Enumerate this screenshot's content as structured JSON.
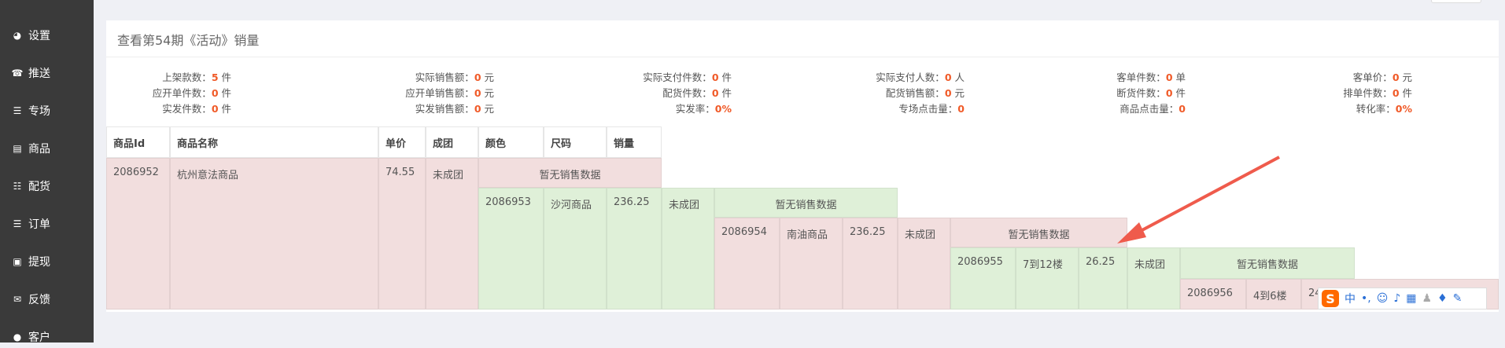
{
  "sidebar": {
    "items": [
      {
        "label": "设置",
        "icon": "dashboard-icon",
        "glyph": "◕"
      },
      {
        "label": "推送",
        "icon": "phone-icon",
        "glyph": "☎"
      },
      {
        "label": "专场",
        "icon": "list-icon",
        "glyph": "☰"
      },
      {
        "label": "商品",
        "icon": "card-icon",
        "glyph": "▤"
      },
      {
        "label": "配货",
        "icon": "list-ol-icon",
        "glyph": "☷"
      },
      {
        "label": "订单",
        "icon": "list-icon",
        "glyph": "☰"
      },
      {
        "label": "提现",
        "icon": "money-icon",
        "glyph": "▣"
      },
      {
        "label": "反馈",
        "icon": "comments-icon",
        "glyph": "✉"
      },
      {
        "label": "客户",
        "icon": "user-icon",
        "glyph": "●"
      }
    ]
  },
  "panel": {
    "title": "查看第54期《活动》销量"
  },
  "stats": [
    {
      "label": "上架款数：",
      "value": "5",
      "unit": " 件"
    },
    {
      "label": "应开单件数：",
      "value": "0",
      "unit": " 件"
    },
    {
      "label": "实发件数：",
      "value": "0",
      "unit": " 件"
    },
    {
      "label": "实际销售额：",
      "value": "0",
      "unit": " 元"
    },
    {
      "label": "应开单销售额：",
      "value": "0",
      "unit": " 元"
    },
    {
      "label": "实发销售额：",
      "value": "0",
      "unit": " 元"
    },
    {
      "label": "实际支付件数：",
      "value": "0",
      "unit": " 件"
    },
    {
      "label": "配货件数：",
      "value": "0",
      "unit": " 件"
    },
    {
      "label": "实发率：",
      "value": "0%",
      "unit": ""
    },
    {
      "label": "实际支付人数：",
      "value": "0",
      "unit": " 人"
    },
    {
      "label": "配货销售额：",
      "value": "0",
      "unit": " 元"
    },
    {
      "label": "专场点击量：",
      "value": "0",
      "unit": ""
    },
    {
      "label": "客单件数：",
      "value": "0",
      "unit": " 单"
    },
    {
      "label": "断货件数：",
      "value": "0",
      "unit": " 件"
    },
    {
      "label": "商品点击量：",
      "value": "0",
      "unit": ""
    },
    {
      "label": "客单价：",
      "value": "0",
      "unit": " 元"
    },
    {
      "label": "排单件数：",
      "value": "0",
      "unit": " 件"
    },
    {
      "label": "转化率：",
      "value": "0%",
      "unit": ""
    }
  ],
  "table": {
    "headers": [
      "商品Id",
      "商品名称",
      "单价",
      "成团",
      "颜色",
      "尺码",
      "销量"
    ],
    "no_data": "暂无销售数据",
    "rows": [
      {
        "id": "2086952",
        "name": "杭州意法商品",
        "price": "74.55",
        "group": "未成团"
      },
      {
        "id": "2086953",
        "name": "沙河商品",
        "price": "236.25",
        "group": "未成团"
      },
      {
        "id": "2086954",
        "name": "南油商品",
        "price": "236.25",
        "group": "未成团"
      },
      {
        "id": "2086955",
        "name": "7到12楼",
        "price": "26.25",
        "group": "未成团"
      },
      {
        "id": "2086956",
        "name": "4到6楼",
        "price": "24",
        "group": ""
      }
    ]
  },
  "ime": {
    "logo": "S",
    "mode": "中",
    "punct": "•,",
    "icons": [
      "smiley-icon",
      "mic-icon",
      "keyboard-icon",
      "users-icon",
      "shirt-icon",
      "wrench-icon"
    ]
  },
  "colors": {
    "pink": "#f2dede",
    "green": "#dff0d8",
    "accent": "#f05a28",
    "arrow": "#ef5b4c",
    "sidebar": "#3a3a3a"
  }
}
